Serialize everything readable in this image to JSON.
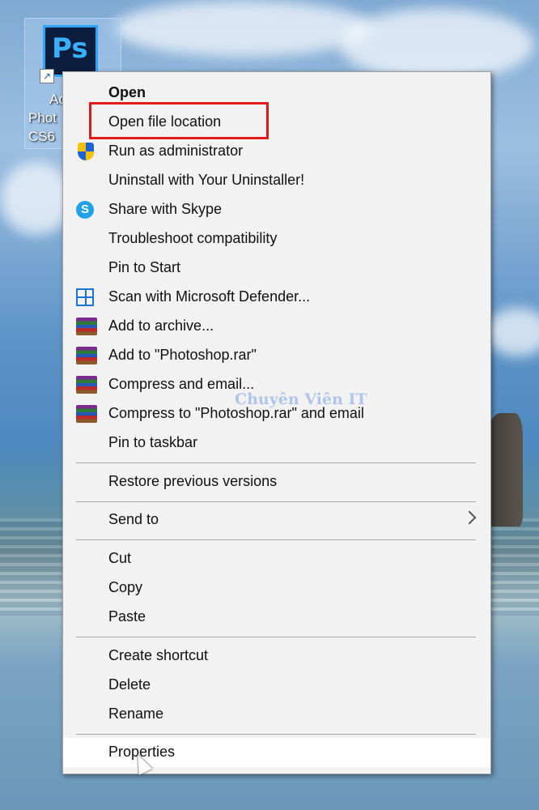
{
  "desktop": {
    "icon_badge": "Ps",
    "icon_label_lines": [
      "Ac",
      "Phot",
      "CS6"
    ]
  },
  "menu": {
    "items": [
      {
        "label": "Open",
        "bold": true
      },
      {
        "label": "Open file location",
        "highlighted": true
      },
      {
        "label": "Run as administrator",
        "icon": "uac-shield-icon"
      },
      {
        "label": "Uninstall with Your Uninstaller!"
      },
      {
        "label": "Share with Skype",
        "icon": "skype-icon"
      },
      {
        "label": "Troubleshoot compatibility"
      },
      {
        "label": "Pin to Start"
      },
      {
        "label": "Scan with Microsoft Defender...",
        "icon": "defender-icon"
      },
      {
        "label": "Add to archive...",
        "icon": "winrar-icon"
      },
      {
        "label": "Add to \"Photoshop.rar\"",
        "icon": "winrar-icon"
      },
      {
        "label": "Compress and email...",
        "icon": "winrar-icon"
      },
      {
        "label": "Compress to \"Photoshop.rar\" and email",
        "icon": "winrar-icon"
      },
      {
        "label": "Pin to taskbar"
      },
      {
        "label": "Restore previous versions"
      },
      {
        "label": "Send to",
        "submenu": true
      },
      {
        "label": "Cut"
      },
      {
        "label": "Copy"
      },
      {
        "label": "Paste"
      },
      {
        "label": "Create shortcut"
      },
      {
        "label": "Delete"
      },
      {
        "label": "Rename"
      },
      {
        "label": "Properties",
        "hovered": true
      }
    ]
  },
  "watermark": "Chuyên Viên IT",
  "colors": {
    "highlight_box": "#e01919",
    "menu_bg": "#f2f2f2"
  }
}
